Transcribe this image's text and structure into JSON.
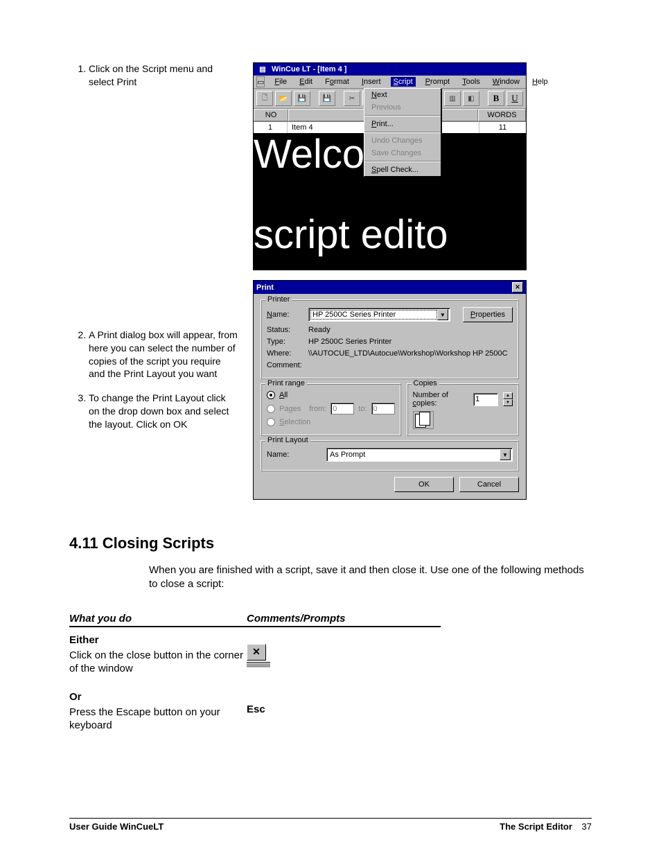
{
  "steps": [
    "Click on the Script menu and select Print",
    "A Print dialog box will appear, from here you can select the number of copies of the script you require and the Print Layout you want",
    "To change the Print Layout click on the drop down box and select the layout. Click on OK"
  ],
  "app": {
    "title": "WinCue LT  - [Item 4 ]",
    "menus": [
      "File",
      "Edit",
      "Format",
      "Insert",
      "Script",
      "Prompt",
      "Tools",
      "Window",
      "Help"
    ],
    "menu_sel_index": 4,
    "dropdown": {
      "items": [
        {
          "label": "Next",
          "enabled": true
        },
        {
          "label": "Previous",
          "enabled": false
        },
        {
          "label": "Print...",
          "enabled": true,
          "u": 0,
          "sep_before": true
        },
        {
          "label": "Undo Changes",
          "enabled": false,
          "sep_before": true
        },
        {
          "label": "Save Changes",
          "enabled": false
        },
        {
          "label": "Spell Check...",
          "enabled": true,
          "u": 0,
          "sep_before": true
        }
      ]
    },
    "columns": {
      "no": "NO",
      "words": "WORDS",
      "no_val": "1",
      "item": "Item 4",
      "words_val": "11"
    },
    "editor_line1": "Welcome",
    "editor_line2": "script edito",
    "bold": "B",
    "under": "U"
  },
  "print": {
    "title": "Print",
    "printer": {
      "legend": "Printer",
      "name_label": "Name:",
      "name": "HP 2500C Series Printer",
      "properties": "Properties",
      "status_label": "Status:",
      "status": "Ready",
      "type_label": "Type:",
      "type": "HP 2500C Series Printer",
      "where_label": "Where:",
      "where": "\\\\AUTOCUE_LTD\\Autocue\\Workshop\\Workshop HP 2500C",
      "comment_label": "Comment:"
    },
    "range": {
      "legend": "Print range",
      "all": "All",
      "pages": "Pages",
      "from": "from:",
      "to": "to:",
      "from_v": "0",
      "to_v": "0",
      "selection": "Selection"
    },
    "copies": {
      "legend": "Copies",
      "num_label": "Number of copies:",
      "num": "1"
    },
    "layout": {
      "legend": "Print Layout",
      "name_label": "Name:",
      "name": "As Prompt"
    },
    "ok": "OK",
    "cancel": "Cancel"
  },
  "section": {
    "heading": "4.11  Closing Scripts",
    "para": "When you are finished with a script, save it and then close it. Use one of the following methods to close a script:",
    "col_a": "What you do",
    "col_b": "Comments/Prompts",
    "either": "Either",
    "either_text": "Click on the close button in the corner of the window",
    "or": "Or",
    "or_text": "Press the Escape button on your keyboard",
    "esc": "Esc"
  },
  "footer": {
    "left": "User Guide WinCueLT",
    "right": "The Script Editor",
    "page": "37"
  }
}
